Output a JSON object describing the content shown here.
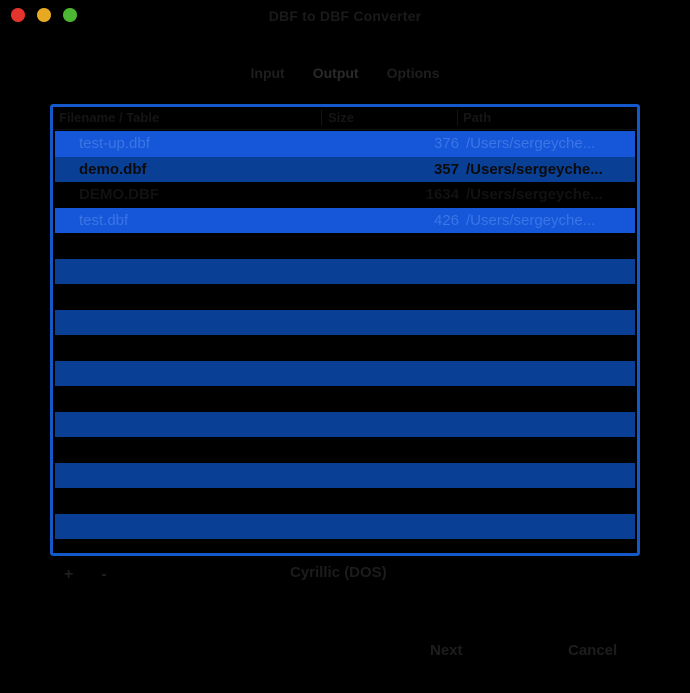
{
  "window": {
    "title": "DBF to DBF Converter"
  },
  "tabs": [
    {
      "label": "Input"
    },
    {
      "label": "Output"
    },
    {
      "label": "Options"
    }
  ],
  "table": {
    "columns": {
      "name": "Filename / Table",
      "size": "Size",
      "path": "Path"
    },
    "rows": [
      {
        "name": "test-up.dbf",
        "size": "376",
        "path": "/Users/sergeyche..."
      },
      {
        "name": "demo.dbf",
        "size": "357",
        "path": "/Users/sergeyche..."
      },
      {
        "name": "DEMO.DBF",
        "size": "1634",
        "path": "/Users/sergeyche..."
      },
      {
        "name": "test.dbf",
        "size": "426",
        "path": "/Users/sergeyche..."
      }
    ]
  },
  "controls": {
    "add_symbol": "+",
    "remove_symbol": "-",
    "encoding": "Cyrillic (DOS)"
  },
  "buttons": {
    "next": "Next",
    "cancel": "Cancel"
  },
  "colors": {
    "accent": "#1557d8",
    "stripe": "#0a3f96",
    "close": "#e5342d",
    "minimize": "#e7a91f",
    "maximize": "#4cb733"
  }
}
